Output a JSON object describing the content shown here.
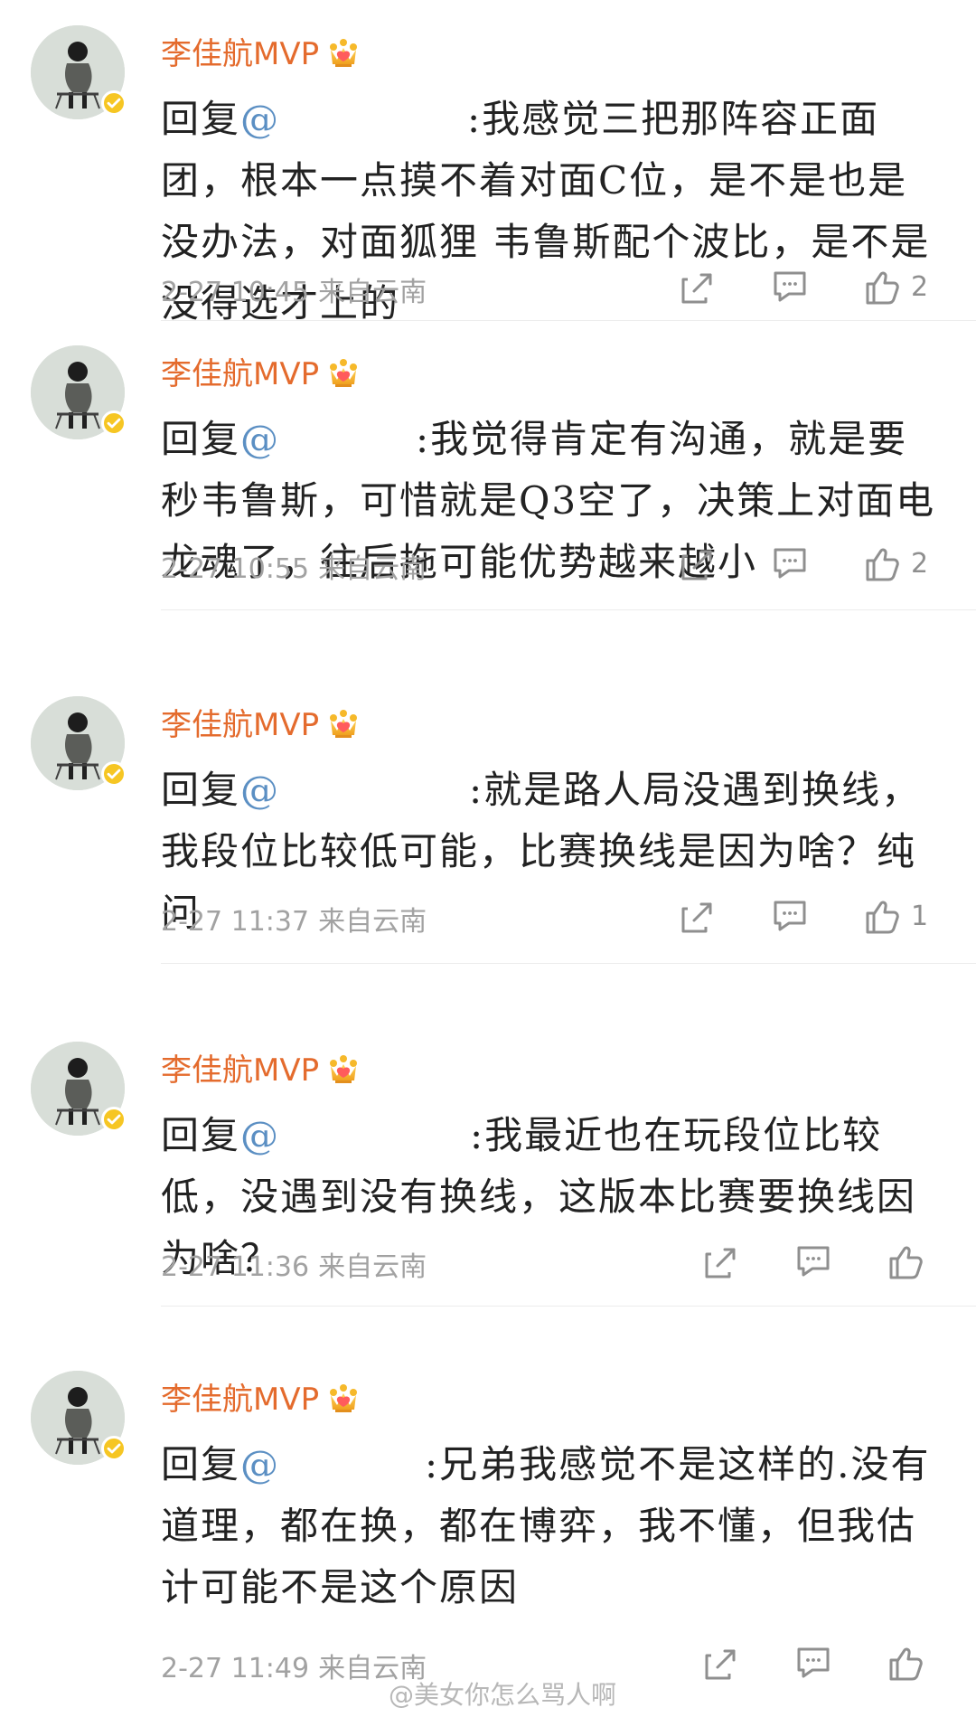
{
  "comments": [
    {
      "username": "李佳航MVP",
      "reply_prefix": "回复",
      "mention": "@",
      "reply_text": ":我感觉三把那阵容正面团，根本一点摸不着对面C位，是不是也是没办法，对面狐狸 韦鲁斯配个波比，是不是没得选才上的",
      "date": "2-27 10:45",
      "source": "来自云南",
      "likes": "2"
    },
    {
      "username": "李佳航MVP",
      "reply_prefix": "回复",
      "mention": "@",
      "reply_text": ":我觉得肯定有沟通，就是要秒韦鲁斯，可惜就是Q3空了，决策上对面电龙魂了，往后拖可能优势越来越小",
      "date": "2-27 10:55",
      "source": "来自云南",
      "likes": "2"
    },
    {
      "username": "李佳航MVP",
      "reply_prefix": "回复",
      "mention": "@",
      "reply_text": ":就是路人局没遇到换线，我段位比较低可能，比赛换线是因为啥？纯问",
      "date": "2-27 11:37",
      "source": "来自云南",
      "likes": "1"
    },
    {
      "username": "李佳航MVP",
      "reply_prefix": "回复",
      "mention": "@",
      "reply_text": ":我最近也在玩段位比较低，没遇到没有换线，这版本比赛要换线因为啥？",
      "date": "2-27 11:36",
      "source": "来自云南",
      "likes": ""
    },
    {
      "username": "李佳航MVP",
      "reply_prefix": "回复",
      "mention": "@",
      "reply_text": ":兄弟我感觉不是这样的.没有道理，都在换，都在博弈，我不懂，但我估计可能不是这个原因",
      "date": "2-27 11:49",
      "source": "来自云南",
      "likes": ""
    }
  ],
  "watermark": "@美女你怎么骂人啊",
  "colors": {
    "username": "#e46b2d",
    "mention": "#5b8fc3",
    "text": "#222222",
    "meta": "#a2a2a2",
    "divider": "#ececec"
  },
  "icons": {
    "crown": "crown-icon",
    "verified": "verified-badge-icon",
    "share": "share-icon",
    "comment": "comment-icon",
    "like": "thumbs-up-icon"
  }
}
